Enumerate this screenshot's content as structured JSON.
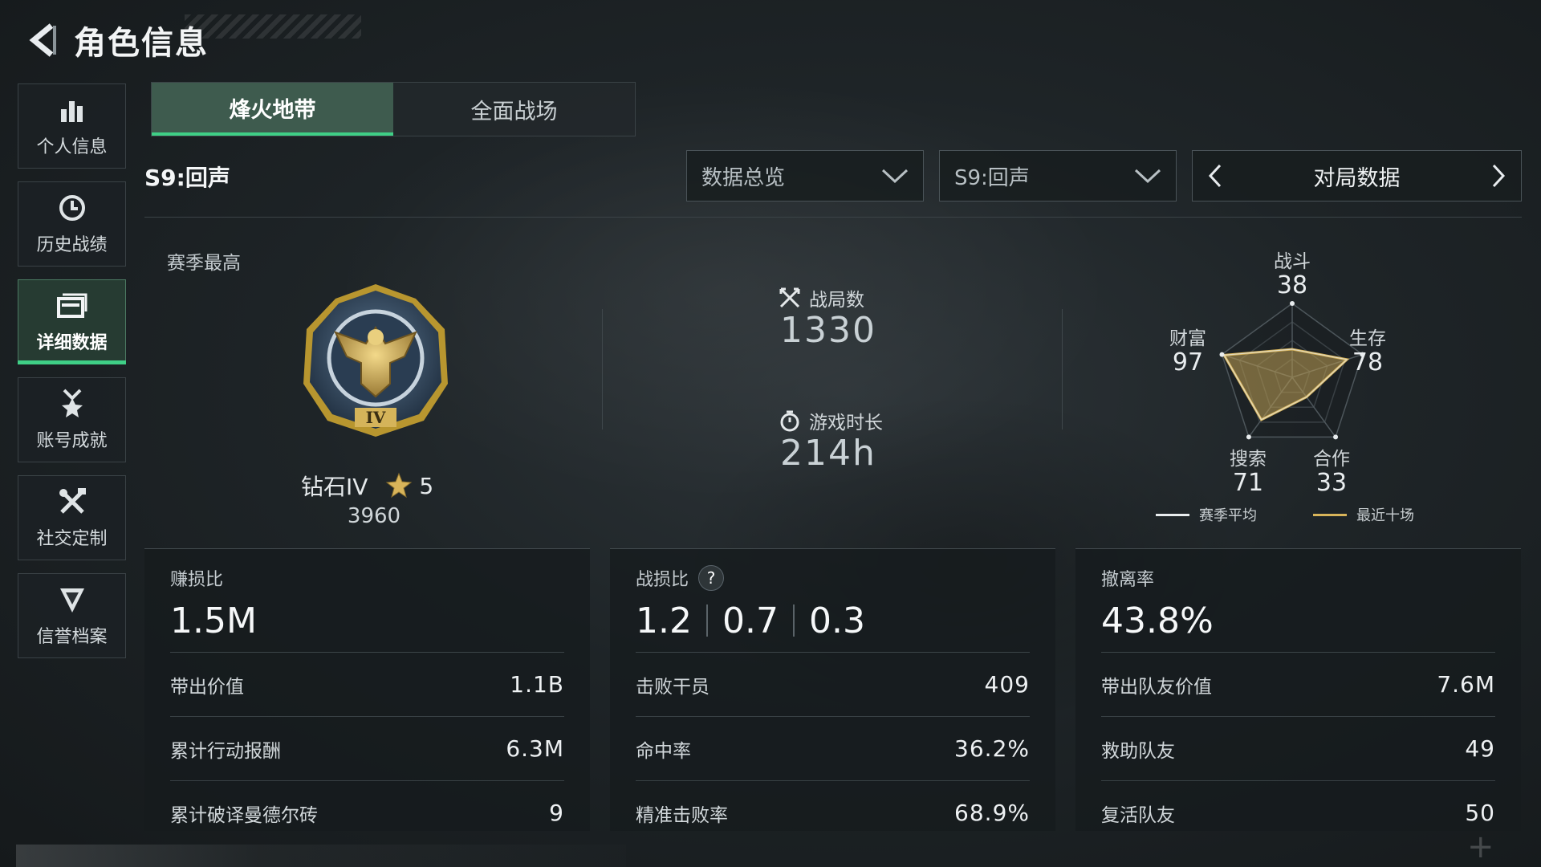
{
  "header": {
    "title": "角色信息"
  },
  "sidebar": {
    "items": [
      {
        "label": "个人信息",
        "icon": "bar-chart-icon"
      },
      {
        "label": "历史战绩",
        "icon": "clock-icon"
      },
      {
        "label": "详细数据",
        "icon": "folder-icon",
        "active": true
      },
      {
        "label": "账号成就",
        "icon": "medal-icon"
      },
      {
        "label": "社交定制",
        "icon": "tools-icon"
      },
      {
        "label": "信誉档案",
        "icon": "shield-icon"
      }
    ]
  },
  "tabs": [
    {
      "label": "烽火地带",
      "active": true
    },
    {
      "label": "全面战场",
      "active": false
    }
  ],
  "toolbar": {
    "season": "S9:回声",
    "dropdown_view": "数据总览",
    "dropdown_season": "S9:回声",
    "pager_label": "对局数据"
  },
  "summary": {
    "season_best_label": "赛季最高",
    "rank_name": "钻石IV",
    "rank_stars": "5",
    "rank_points": "3960",
    "badge_numeral": "IV",
    "matches_label": "战局数",
    "matches_value": "1330",
    "playtime_label": "游戏时长",
    "playtime_value": "214h"
  },
  "radar": {
    "axes": [
      {
        "label": "战斗",
        "value": "38"
      },
      {
        "label": "生存",
        "value": "78"
      },
      {
        "label": "合作",
        "value": "33"
      },
      {
        "label": "搜索",
        "value": "71"
      },
      {
        "label": "财富",
        "value": "97"
      }
    ],
    "legend_season": "赛季平均",
    "legend_recent": "最近十场",
    "color_season": "#e8ecee",
    "color_recent": "#d8b45a"
  },
  "cards": {
    "profit": {
      "title": "赚损比",
      "big": "1.5M",
      "rows": [
        {
          "label": "带出价值",
          "value": "1.1B"
        },
        {
          "label": "累计行动报酬",
          "value": "6.3M"
        },
        {
          "label": "累计破译曼德尔砖",
          "value": "9"
        }
      ]
    },
    "combat": {
      "title": "战损比",
      "help": "?",
      "ratios": [
        "1.2",
        "0.7",
        "0.3"
      ],
      "rows": [
        {
          "label": "击败干员",
          "value": "409"
        },
        {
          "label": "命中率",
          "value": "36.2%"
        },
        {
          "label": "精准击败率",
          "value": "68.9%"
        }
      ]
    },
    "extract": {
      "title": "撤离率",
      "big": "43.8%",
      "rows": [
        {
          "label": "带出队友价值",
          "value": "7.6M"
        },
        {
          "label": "救助队友",
          "value": "49"
        },
        {
          "label": "复活队友",
          "value": "50"
        }
      ]
    }
  },
  "colors": {
    "accent": "#3fcf86",
    "gold": "#d8b45a"
  }
}
